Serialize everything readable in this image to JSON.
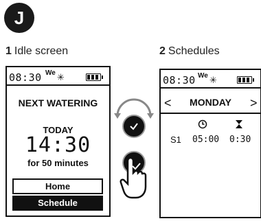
{
  "badge": "J",
  "captions": [
    {
      "num": "1",
      "text": "Idle screen"
    },
    {
      "num": "2",
      "text": "Schedules"
    }
  ],
  "idle_screen": {
    "time": "08:30",
    "day": "We",
    "next_watering": "NEXT WATERING",
    "today": "TODAY",
    "start_time": "14:30",
    "duration": "for 50 minutes",
    "home_label": "Home",
    "schedule_label": "Schedule"
  },
  "schedules_screen": {
    "time": "08:30",
    "day": "We",
    "prev_arrow": "<",
    "next_arrow": ">",
    "day_name": "MONDAY",
    "rows": [
      {
        "id": "S1",
        "start": "05:00",
        "duration": "0:30"
      }
    ]
  },
  "icons": {
    "sun": "sun-icon",
    "battery": "battery-icon",
    "clock": "clock-icon",
    "hourglass": "hourglass-icon",
    "dial": "rotary-dial-icon",
    "ok": "check-icon",
    "hand": "hand-press-icon"
  }
}
